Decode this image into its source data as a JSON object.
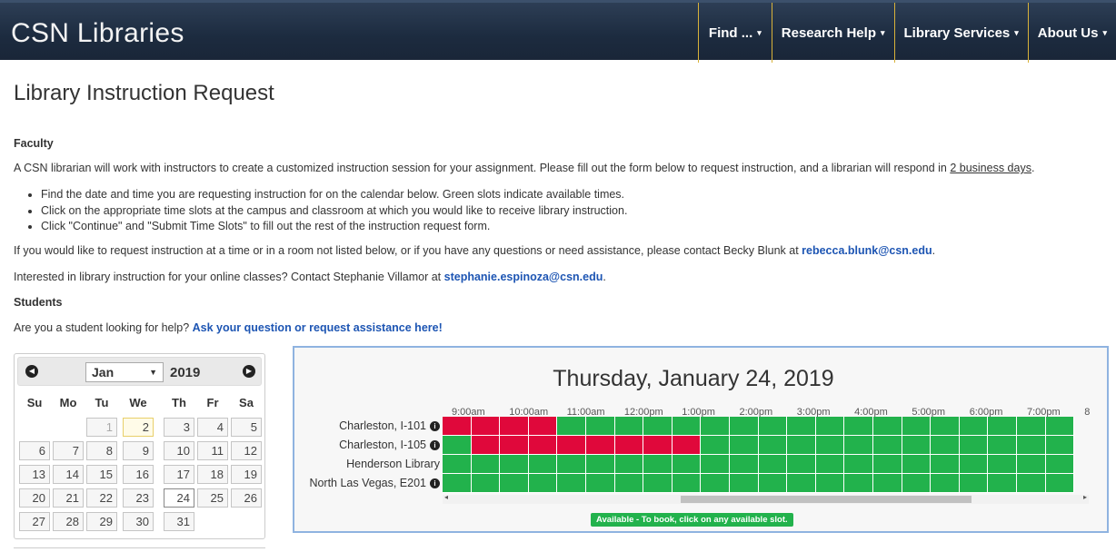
{
  "header": {
    "brand": "CSN Libraries",
    "nav": [
      {
        "label": "Find ...",
        "caret": "▾"
      },
      {
        "label": "Research Help",
        "caret": "▾"
      },
      {
        "label": "Library Services",
        "caret": "▾"
      },
      {
        "label": "About Us",
        "caret": "▾"
      }
    ]
  },
  "page": {
    "title": "Library Instruction Request",
    "faculty_heading": "Faculty",
    "intro_text": "A CSN librarian will work with instructors to create a customized instruction session for your assignment. Please fill out the form below to request instruction, and a librarian will respond in ",
    "intro_link": "2 business days",
    "intro_end": ".",
    "bullets": [
      "Find the date and time you are requesting instruction for on the calendar below. Green slots indicate available times.",
      "Click on the appropriate time slots at the campus and classroom at which you would like to receive library instruction.",
      "Click \"Continue\" and \"Submit Time Slots\" to fill out the rest of the instruction request form."
    ],
    "request_text": "If you would like to request instruction at a time or in a room not listed below, or if you have any questions or need assistance, please contact Becky Blunk at ",
    "request_email": "rebecca.blunk@csn.edu",
    "request_end": ".",
    "online_text": "Interested in library instruction for your online classes? Contact Stephanie Villamor at ",
    "online_email": "stephanie.espinoza@csn.edu",
    "online_end": ".",
    "students_heading": "Students",
    "student_text": "Are you a student looking for help? ",
    "student_link": "Ask your question or request assistance here!"
  },
  "datepicker": {
    "prev_icon": "circle-arrow-left-icon",
    "next_icon": "circle-arrow-right-icon",
    "month": "Jan",
    "year": "2019",
    "weekdays": [
      "Su",
      "Mo",
      "Tu",
      "We",
      "Th",
      "Fr",
      "Sa"
    ],
    "weeks": [
      [
        "",
        "",
        "1",
        "2",
        "3",
        "4",
        "5"
      ],
      [
        "6",
        "7",
        "8",
        "9",
        "10",
        "11",
        "12"
      ],
      [
        "13",
        "14",
        "15",
        "16",
        "17",
        "18",
        "19"
      ],
      [
        "20",
        "21",
        "22",
        "23",
        "24",
        "25",
        "26"
      ],
      [
        "27",
        "28",
        "29",
        "30",
        "31",
        "",
        ""
      ]
    ],
    "today": "2",
    "selected": "24",
    "disabled": [
      "1"
    ]
  },
  "scheduler": {
    "date_title": "Thursday, January 24, 2019",
    "times": [
      "9:00am",
      "10:00am",
      "11:00am",
      "12:00pm",
      "1:00pm",
      "2:00pm",
      "3:00pm",
      "4:00pm",
      "5:00pm",
      "6:00pm",
      "7:00pm",
      "8"
    ],
    "rooms": [
      {
        "name": "Charleston, I-101",
        "info": true,
        "busy_from": 0,
        "busy_to": 3
      },
      {
        "name": "Charleston, I-105",
        "info": true,
        "busy_from": 1,
        "busy_to": 8
      },
      {
        "name": "Henderson Library",
        "info": false,
        "busy_from": -1,
        "busy_to": -1
      },
      {
        "name": "North Las Vegas, E201",
        "info": true,
        "busy_from": -1,
        "busy_to": -1
      }
    ],
    "slot_count": 22,
    "legend": "Available - To book, click on any available slot.",
    "colors": {
      "available": "#22b24c",
      "booked": "#e0083b"
    }
  }
}
